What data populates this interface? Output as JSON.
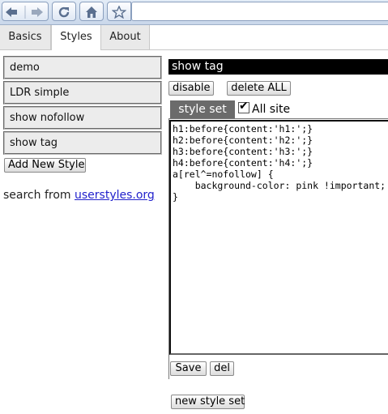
{
  "browser": {
    "icons": [
      "back-arrow-icon",
      "forward-arrow-icon",
      "reload-icon",
      "home-icon",
      "star-icon"
    ]
  },
  "tabs": [
    {
      "label": "Basics",
      "active": false
    },
    {
      "label": "Styles",
      "active": true
    },
    {
      "label": "About",
      "active": false
    }
  ],
  "styles_list": {
    "items": [
      "demo",
      "LDR simple",
      "show nofollow",
      "show tag"
    ],
    "add_button": "Add New Style",
    "search_prefix": "search from ",
    "search_link": "userstyles.org"
  },
  "editor": {
    "name_value": "show tag",
    "disable_button": "disable",
    "delete_all_button": "delete ALL",
    "style_set_tab": "style set",
    "all_site_label": "All site",
    "all_site_checked": true,
    "code": "h1:before{content:'h1:';}\nh2:before{content:'h2:';}\nh3:before{content:'h3:';}\nh4:before{content:'h4:';}\na[rel^=nofollow] {\n    background-color: pink !important;\n}",
    "save_button": "Save",
    "del_button": "del",
    "new_style_set_button": "new style set"
  }
}
